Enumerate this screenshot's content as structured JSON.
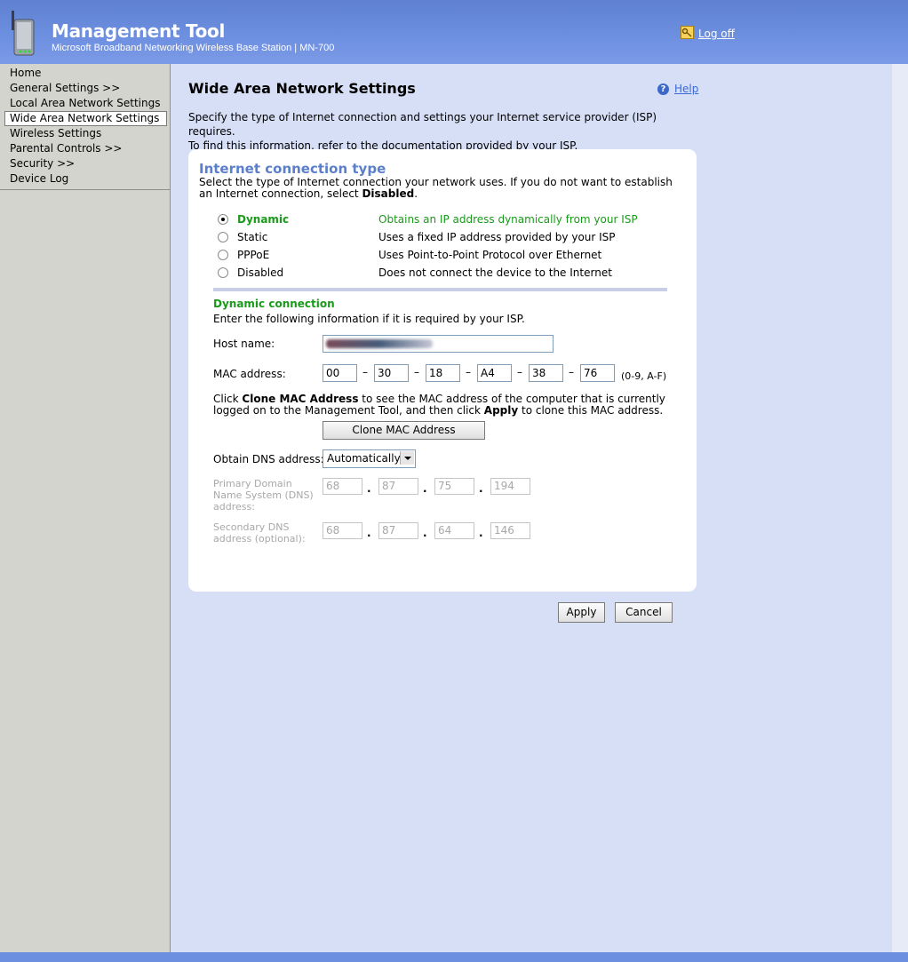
{
  "header": {
    "title": "Management Tool",
    "subtitle": "Microsoft Broadband Networking Wireless Base Station | MN-700",
    "logoff_label": "Log off"
  },
  "sidebar": {
    "items": [
      {
        "label": "Home"
      },
      {
        "label": "General Settings >>"
      },
      {
        "label": "Local Area Network Settings"
      },
      {
        "label": "Wide Area Network Settings",
        "active": true
      },
      {
        "label": "Wireless Settings"
      },
      {
        "label": "Parental Controls >>"
      },
      {
        "label": "Security >>"
      },
      {
        "label": "Device Log"
      }
    ]
  },
  "page": {
    "title": "Wide Area Network Settings",
    "help_label": "Help",
    "intro_line1": "Specify the type of Internet connection and settings your Internet service provider (ISP) requires.",
    "intro_line2": "To find this information, refer to the documentation provided by your ISP."
  },
  "connection": {
    "title": "Internet connection type",
    "desc_prefix": "Select the type of Internet connection your network uses. If you do not want to establish an Internet connection, select ",
    "desc_bold": "Disabled",
    "desc_suffix": ".",
    "options": [
      {
        "label": "Dynamic",
        "desc": "Obtains an IP address dynamically from your ISP",
        "selected": true
      },
      {
        "label": "Static",
        "desc": "Uses a fixed IP address provided by your ISP",
        "selected": false
      },
      {
        "label": "PPPoE",
        "desc": "Uses Point-to-Point Protocol over Ethernet",
        "selected": false
      },
      {
        "label": "Disabled",
        "desc": "Does not connect the device to the Internet",
        "selected": false
      }
    ]
  },
  "dynamic": {
    "title": "Dynamic connection",
    "desc": "Enter the following information if it is required by your ISP.",
    "host_label": "Host name:",
    "mac_label": "MAC address:",
    "mac_octets": [
      "00",
      "30",
      "18",
      "A4",
      "38",
      "76"
    ],
    "mac_hint": "(0-9, A-F)",
    "clone_text_1": "Click ",
    "clone_text_bold1": "Clone MAC Address",
    "clone_text_2": " to see the MAC address of the computer that is currently logged on to the Management Tool, and then click ",
    "clone_text_bold2": "Apply",
    "clone_text_3": " to clone this MAC address.",
    "clone_button": "Clone MAC Address",
    "dns_label": "Obtain DNS address:",
    "dns_value": "Automatically",
    "primary_dns_label": "Primary Domain Name System (DNS) address:",
    "primary_dns": [
      "68",
      "87",
      "75",
      "194"
    ],
    "secondary_dns_label": "Secondary DNS address (optional):",
    "secondary_dns": [
      "68",
      "87",
      "64",
      "146"
    ]
  },
  "actions": {
    "apply": "Apply",
    "cancel": "Cancel"
  },
  "colors": {
    "header_blue": "#6d8fe0",
    "accent_green": "#1a9a1a",
    "section_title": "#5b7fca",
    "link": "#3a6ad4"
  }
}
